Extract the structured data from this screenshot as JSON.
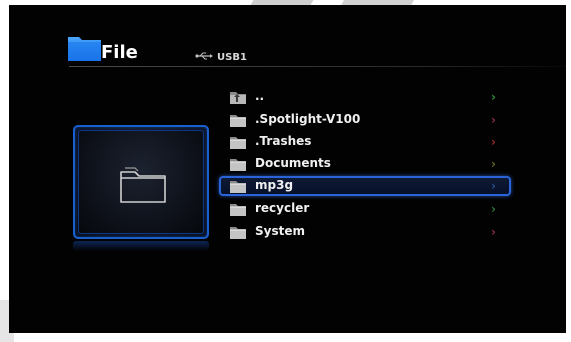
{
  "header": {
    "title": "File",
    "device_label": "USB1"
  },
  "files": [
    {
      "name": "..",
      "chevron_color": "#2f8a3a",
      "icon": "up-folder-icon",
      "selected": false
    },
    {
      "name": ".Spotlight-V100",
      "chevron_color": "#8c2a55",
      "icon": "folder-icon",
      "selected": false
    },
    {
      "name": ".Trashes",
      "chevron_color": "#9a2a2a",
      "icon": "folder-icon",
      "selected": false
    },
    {
      "name": "Documents",
      "chevron_color": "#6a6a2a",
      "icon": "folder-icon",
      "selected": false
    },
    {
      "name": "mp3g",
      "chevron_color": "#2a4f8a",
      "icon": "folder-icon",
      "selected": true
    },
    {
      "name": "recycler",
      "chevron_color": "#2f7a3a",
      "icon": "folder-icon",
      "selected": false
    },
    {
      "name": "System",
      "chevron_color": "#8c2a55",
      "icon": "folder-icon",
      "selected": false
    }
  ],
  "colors": {
    "accent": "#1a5fcf",
    "background": "#020202"
  }
}
